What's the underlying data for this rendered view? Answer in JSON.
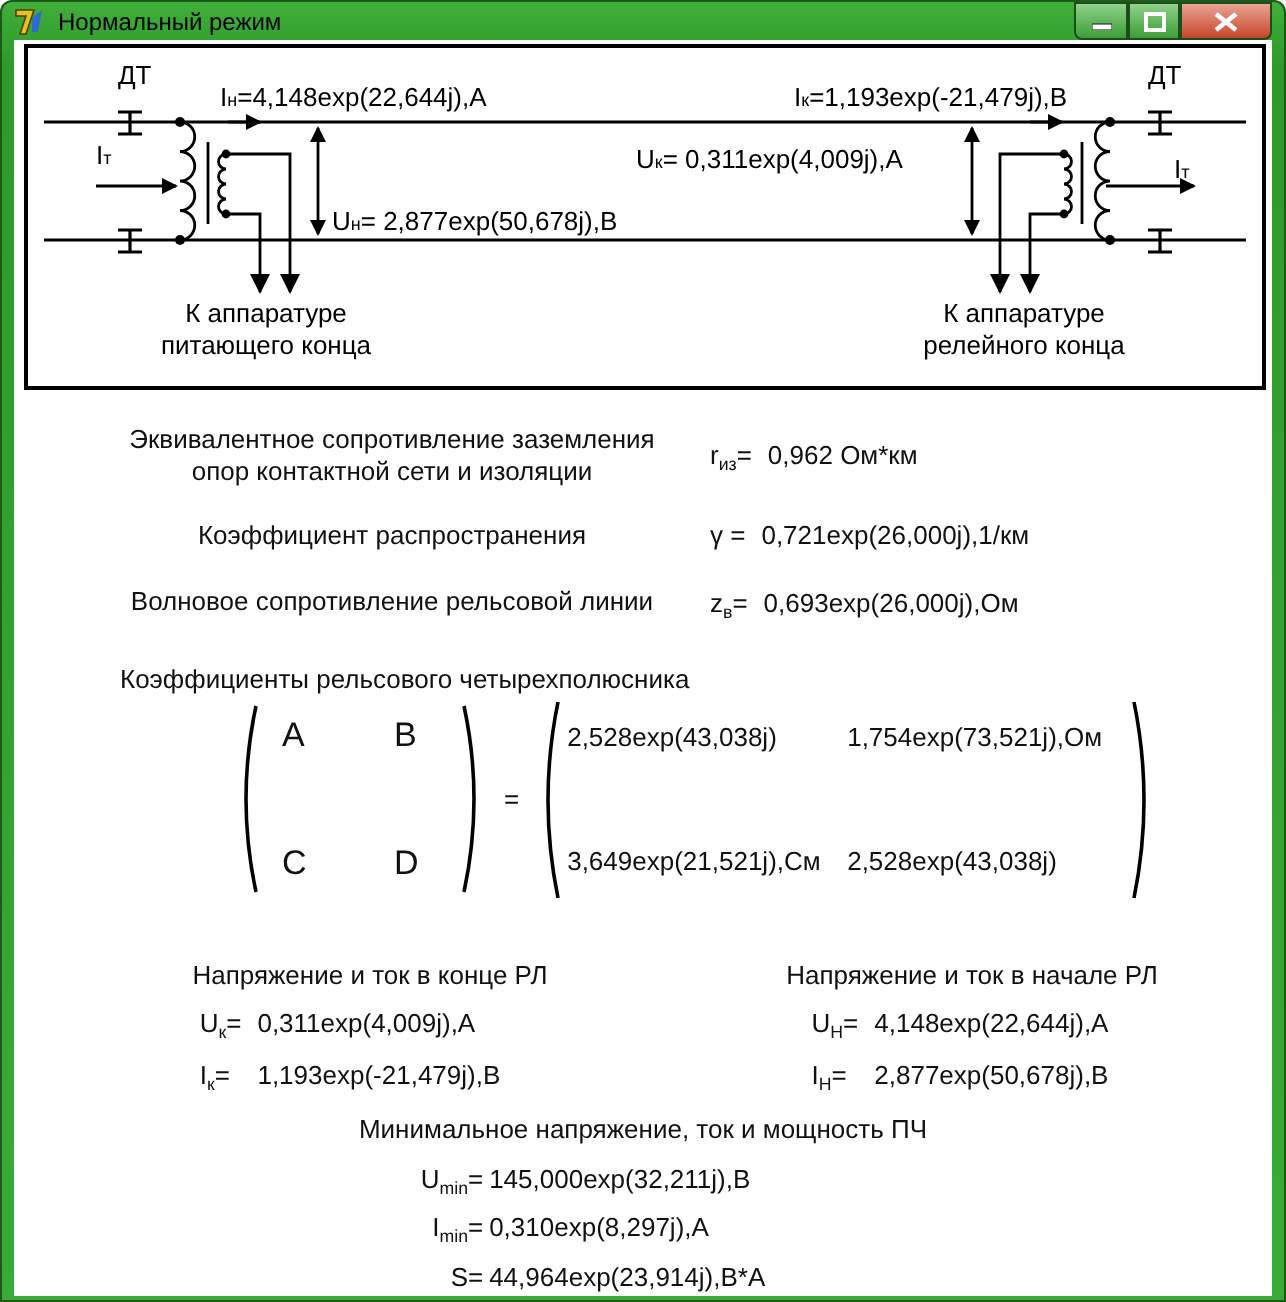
{
  "window": {
    "title": "Нормальный режим"
  },
  "diagram": {
    "left": {
      "label": "ДТ",
      "tc_current": "I$_{т}$",
      "line_current": "I$_{н}$=4,148exp(22,644j),A",
      "voltage": "U$_{н}$= 2,877exp(50,678j),B",
      "caption": [
        "К аппаратуре",
        "питающего конца"
      ]
    },
    "right": {
      "label": "ДТ",
      "tc_current": "I$_{т}$",
      "line_current": "I$_{к}$=1,193exp(-21,479j),B",
      "voltage": "U$_{к}$= 0,311exp(4,009j),A",
      "caption": [
        "К аппаратуре",
        "релейного конца"
      ]
    }
  },
  "parameters": [
    {
      "lines": [
        "Эквивалентное сопротивление заземления",
        "опор контактной сети и изоляции"
      ],
      "symbol": "r$_{из}$=",
      "value": "0,962 Ом*км"
    },
    {
      "lines": [
        "Коэффициент распространения"
      ],
      "symbol": "γ =",
      "value": "0,721exp(26,000j),1/км"
    },
    {
      "lines": [
        "Волновое сопротивление рельсовой линии"
      ],
      "symbol": "z$_{в}$=",
      "value": "0,693exp(26,000j),Ом"
    }
  ],
  "matrix": {
    "title": "Коэффициенты рельсового четырехполюсника",
    "symbols": [
      "A",
      "B",
      "C",
      "D"
    ],
    "equals": "=",
    "values": [
      "2,528exp(43,038j)",
      "1,754exp(73,521j),Ом",
      "3,649exp(21,521j),См",
      "2,528exp(43,038j)"
    ]
  },
  "end_values": {
    "title": "Напряжение и ток в конце РЛ",
    "rows": [
      {
        "symbol": "U$_{к}$=",
        "value": "0,311exp(4,009j),A"
      },
      {
        "symbol": "I$_{к}$=",
        "value": "1,193exp(-21,479j),B"
      }
    ]
  },
  "start_values": {
    "title": "Напряжение и ток в начале РЛ",
    "rows": [
      {
        "symbol": "U$_{H}$=",
        "value": "4,148exp(22,644j),A"
      },
      {
        "symbol": "I$_{H}$=",
        "value": "2,877exp(50,678j),B"
      }
    ]
  },
  "minimum": {
    "title": "Минимальное напряжение, ток и мощность ПЧ",
    "rows": [
      {
        "symbol": "U$_{min}$=",
        "value": "145,000exp(32,211j),B"
      },
      {
        "symbol": "I$_{min}$=",
        "value": "0,310exp(8,297j),A"
      },
      {
        "symbol": "S=",
        "value": "44,964exp(23,914j),B*A"
      }
    ]
  }
}
